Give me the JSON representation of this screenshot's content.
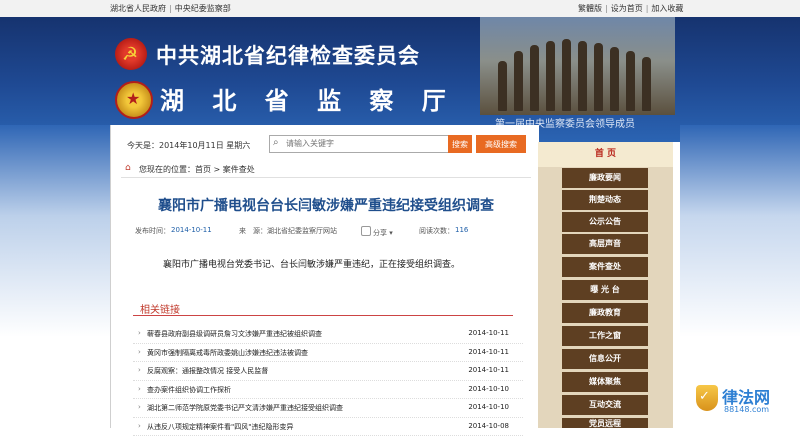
{
  "topbar": {
    "left_links": [
      "湖北省人民政府",
      "中央纪委监察部"
    ],
    "right_links": [
      "繁體版",
      "设为首页",
      "加入收藏"
    ]
  },
  "banner": {
    "title_cpc": "中共湖北省纪律检查委员会",
    "title_supervision": "湖 北 省 监 察 厅",
    "photo_caption": "第一届中央监察委员会领导成员"
  },
  "toolbar": {
    "date_text": "今天是：2014年10月11日 星期六",
    "search_placeholder": "请输入关键字",
    "search_button": "搜索",
    "advanced_search_button": "高级搜索"
  },
  "breadcrumb": {
    "label": "您现在的位置：首页 > 案件查处"
  },
  "article": {
    "title": "襄阳市广播电视台台长闫敏涉嫌严重违纪接受组织调查",
    "publish_label": "发布时间：",
    "publish_date": "2014-10-11",
    "source_label": "来　源：湖北省纪委监察厅网站",
    "share_label": "分享 ▾",
    "views_label": "阅读次数：",
    "views": "116",
    "body": "襄阳市广播电视台党委书记、台长闫敏涉嫌严重违纪，正在接受组织调查。"
  },
  "related": {
    "heading": "相关链接",
    "items": [
      {
        "title": "蕲春县政府副县级调研员詹习文涉嫌严重违纪被组织调查",
        "date": "2014-10-11"
      },
      {
        "title": "黄冈市强制隔离戒毒所政委姚山涉嫌违纪违法被调查",
        "date": "2014-10-11"
      },
      {
        "title": "反腐观察：通报整改情况 接受人民监督",
        "date": "2014-10-11"
      },
      {
        "title": "查办案件组织协调工作探析",
        "date": "2014-10-10"
      },
      {
        "title": "湖北第二师范学院原党委书记严文清涉嫌严重违纪接受组织调查",
        "date": "2014-10-10"
      },
      {
        "title": "从违反八项规定精神案件看\"四风\"违纪隐形变异",
        "date": "2014-10-08"
      }
    ]
  },
  "sidebar": {
    "items": [
      {
        "label": "首 页"
      },
      {
        "label": "廉政要闻"
      },
      {
        "label": "荆楚动态"
      },
      {
        "label": "公示公告"
      },
      {
        "label": "高层声音"
      },
      {
        "label": "案件查处"
      },
      {
        "label": "曝 光 台"
      },
      {
        "label": "廉政教育"
      },
      {
        "label": "工作之窗"
      },
      {
        "label": "信息公开"
      },
      {
        "label": "媒体聚焦"
      },
      {
        "label": "互动交流"
      },
      {
        "label": "党员远程"
      }
    ]
  },
  "watermark": {
    "name": "律法网",
    "url": "88148.com"
  }
}
